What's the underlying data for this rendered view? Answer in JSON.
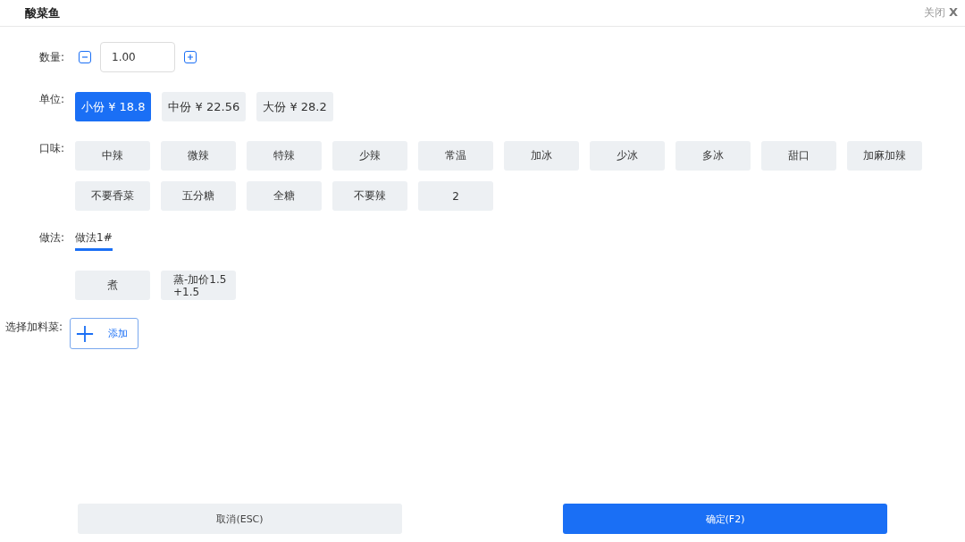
{
  "window": {
    "title": "酸菜鱼",
    "close_label": "关闭",
    "close_glyph": "X"
  },
  "quantity": {
    "label": "数量:",
    "value": "1.00"
  },
  "unit": {
    "label": "单位:",
    "options": [
      {
        "label": "小份 ¥ 18.8",
        "selected": true
      },
      {
        "label": "中份 ¥ 22.56",
        "selected": false
      },
      {
        "label": "大份 ¥ 28.2",
        "selected": false
      }
    ]
  },
  "taste": {
    "label": "口味:",
    "options": [
      {
        "label": "中辣",
        "selected": false
      },
      {
        "label": "微辣",
        "selected": false
      },
      {
        "label": "特辣",
        "selected": false
      },
      {
        "label": "少辣",
        "selected": false
      },
      {
        "label": "常温",
        "selected": false
      },
      {
        "label": "加冰",
        "selected": false
      },
      {
        "label": "少冰",
        "selected": false
      },
      {
        "label": "多冰",
        "selected": false
      },
      {
        "label": "甜口",
        "selected": false
      },
      {
        "label": "加麻加辣",
        "selected": false
      },
      {
        "label": "不要香菜",
        "selected": false
      },
      {
        "label": "五分糖",
        "selected": false
      },
      {
        "label": "全糖",
        "selected": false
      },
      {
        "label": "不要辣",
        "selected": false
      },
      {
        "label": "2",
        "selected": false
      }
    ]
  },
  "method": {
    "label": "做法:",
    "tabs": [
      {
        "label": "做法1#",
        "selected": true
      }
    ],
    "options": [
      {
        "label": "煮",
        "selected": false
      },
      {
        "label": "蒸-加价1.5",
        "extra": "+1.5",
        "selected": false
      }
    ]
  },
  "extras": {
    "label": "选择加料菜:",
    "add_label": "添加"
  },
  "buttons": {
    "cancel": "取消(ESC)",
    "confirm": "确定(F2)"
  }
}
